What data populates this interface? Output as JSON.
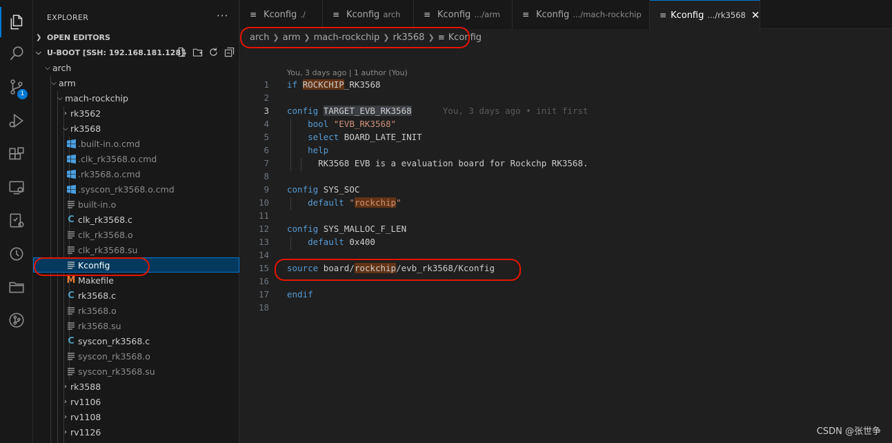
{
  "activity_bar": {
    "items": [
      {
        "name": "explorer-icon",
        "active": true
      },
      {
        "name": "search-icon"
      },
      {
        "name": "source-control-icon",
        "badge": "1"
      },
      {
        "name": "run-debug-icon"
      },
      {
        "name": "extensions-icon"
      },
      {
        "name": "remote-explorer-icon"
      },
      {
        "name": "testing-icon"
      },
      {
        "name": "timeline-icon"
      },
      {
        "name": "folder-icon"
      },
      {
        "name": "git-graph-icon"
      }
    ]
  },
  "sidebar": {
    "title": "EXPLORER",
    "more": "···",
    "open_editors": "OPEN EDITORS",
    "workspace": "U-BOOT [SSH: 192.168.181.128]",
    "tree": [
      {
        "label": "arch",
        "type": "folder-open"
      },
      {
        "label": "arm",
        "type": "folder-open"
      },
      {
        "label": "mach-rockchip",
        "type": "folder-open"
      },
      {
        "label": "rk3562",
        "type": "folder-closed"
      },
      {
        "label": "rk3568",
        "type": "folder-open"
      },
      {
        "label": ".built-in.o.cmd",
        "type": "cmd",
        "dim": true
      },
      {
        "label": ".clk_rk3568.o.cmd",
        "type": "cmd",
        "dim": true
      },
      {
        "label": ".rk3568.o.cmd",
        "type": "cmd",
        "dim": true
      },
      {
        "label": ".syscon_rk3568.o.cmd",
        "type": "cmd",
        "dim": true
      },
      {
        "label": "built-in.o",
        "type": "lines",
        "dim": true
      },
      {
        "label": "clk_rk3568.c",
        "type": "c"
      },
      {
        "label": "clk_rk3568.o",
        "type": "lines",
        "dim": true
      },
      {
        "label": "clk_rk3568.su",
        "type": "lines",
        "dim": true
      },
      {
        "label": "Kconfig",
        "type": "lines",
        "selected": true
      },
      {
        "label": "Makefile",
        "type": "makefile"
      },
      {
        "label": "rk3568.c",
        "type": "c"
      },
      {
        "label": "rk3568.o",
        "type": "lines",
        "dim": true
      },
      {
        "label": "rk3568.su",
        "type": "lines",
        "dim": true
      },
      {
        "label": "syscon_rk3568.c",
        "type": "c"
      },
      {
        "label": "syscon_rk3568.o",
        "type": "lines",
        "dim": true
      },
      {
        "label": "syscon_rk3568.su",
        "type": "lines",
        "dim": true
      },
      {
        "label": "rk3588",
        "type": "folder-closed"
      },
      {
        "label": "rv1106",
        "type": "folder-closed"
      },
      {
        "label": "rv1108",
        "type": "folder-closed"
      },
      {
        "label": "rv1126",
        "type": "folder-closed"
      }
    ]
  },
  "tabs": [
    {
      "name": "Kconfig",
      "desc": "./"
    },
    {
      "name": "Kconfig",
      "desc": "arch"
    },
    {
      "name": "Kconfig",
      "desc": ".../arm"
    },
    {
      "name": "Kconfig",
      "desc": ".../mach-rockchip"
    },
    {
      "name": "Kconfig",
      "desc": ".../rk3568",
      "active": true
    }
  ],
  "breadcrumb": [
    "arch",
    "arm",
    "mach-rockchip",
    "rk3568",
    "Kconfig"
  ],
  "editor": {
    "blame_header": "You, 3 days ago | 1 author (You)",
    "inline_blame": "You, 3 days ago • init first",
    "line_numbers": [
      "1",
      "2",
      "3",
      "4",
      "5",
      "6",
      "7",
      "8",
      "9",
      "10",
      "11",
      "12",
      "13",
      "14",
      "15",
      "16",
      "17",
      "18"
    ],
    "current_line": "3",
    "lines": {
      "l1_kw": "if",
      "l1_hl": "ROCKCHIP",
      "l1_rest": "_RK3568",
      "l3_kw": "config",
      "l3_name": "TARGET_EVB_RK3568",
      "l4_kw": "bool",
      "l4_str": "\"EVB_RK3568\"",
      "l5_kw": "select",
      "l5_rest": "BOARD_LATE_INIT",
      "l6_kw": "help",
      "l7_text": "RK3568 EVB is a evaluation board for Rockchp RK3568.",
      "l9_kw": "config",
      "l9_rest": "SYS_SOC",
      "l10_kw": "default",
      "l10_q1": "\"",
      "l10_hl": "rockchip",
      "l10_q2": "\"",
      "l12_kw": "config",
      "l12_rest": "SYS_MALLOC_F_LEN",
      "l13_kw": "default",
      "l13_rest": "0x400",
      "l15_kw": "source",
      "l15_a": "board/",
      "l15_hl": "rockchip",
      "l15_b": "/evb_rk3568/Kconfig",
      "l17_kw": "endif"
    }
  },
  "watermark": "CSDN @张世争",
  "annotation_color": "#e51400",
  "accent_color": "#0078d4"
}
